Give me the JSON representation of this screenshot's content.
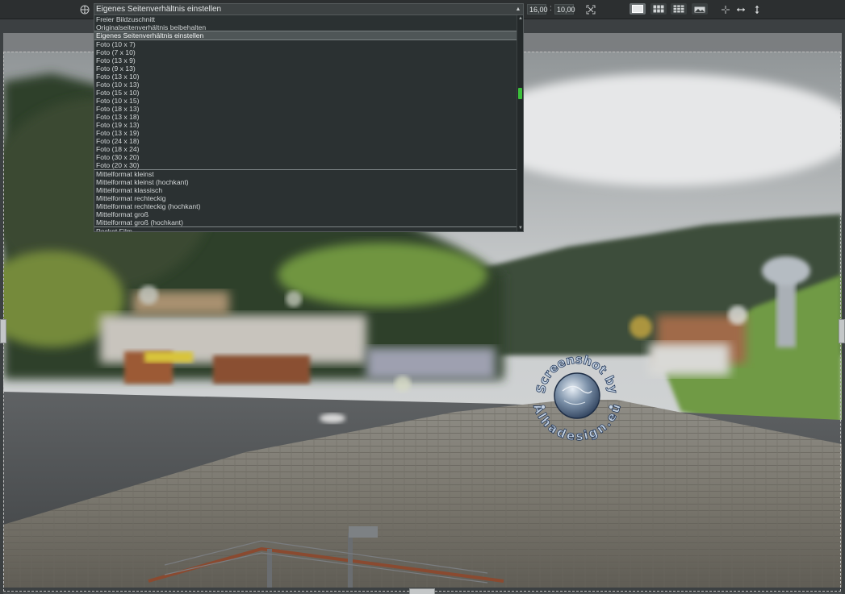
{
  "toolbar": {
    "ratio_select_value": "Eigenes Seitenverhältnis einstellen",
    "width_value": "16,00",
    "height_value": "10,00",
    "colon": ":",
    "icons": [
      "move-icon",
      "fit-icon",
      "single-view-icon",
      "split-view-icon",
      "compare-view-icon",
      "image-view-icon",
      "center-icon",
      "flip-horizontal-icon",
      "flip-vertical-icon"
    ],
    "active_view": "single-view"
  },
  "dropdown": {
    "groups": [
      [
        "Freier Bildzuschnitt",
        "Originalseitenverhältnis beibehalten",
        "Eigenes Seitenverhältnis einstellen"
      ],
      [
        "Foto (10 x 7)",
        "Foto (7 x 10)",
        "Foto (13 x 9)",
        "Foto (9 x 13)",
        "Foto (13 x 10)",
        "Foto (10 x 13)",
        "Foto (15 x 10)",
        "Foto (10 x 15)",
        "Foto (18 x 13)",
        "Foto (13 x 18)",
        "Foto (19 x 13)",
        "Foto (13 x 19)",
        "Foto (24 x 18)",
        "Foto (18 x 24)",
        "Foto (30 x 20)",
        "Foto (20 x 30)"
      ],
      [
        "Mittelformat kleinst",
        "Mittelformat kleinst (hochkant)",
        "Mittelformat klassisch",
        "Mittelformat rechteckig",
        "Mittelformat rechteckig (hochkant)",
        "Mittelformat groß",
        "Mittelformat groß (hochkant)"
      ],
      [
        "Pocket Film"
      ]
    ],
    "selected": "Eigenes Seitenverhältnis einstellen"
  },
  "watermark": {
    "top_text": "Screenshot by",
    "bottom_text": "Alhadesign.eu"
  },
  "colors": {
    "toolbar_bg": "#2c2f30",
    "dropdown_bg": "#2b3132",
    "scroll_thumb": "#3bbf3b"
  }
}
